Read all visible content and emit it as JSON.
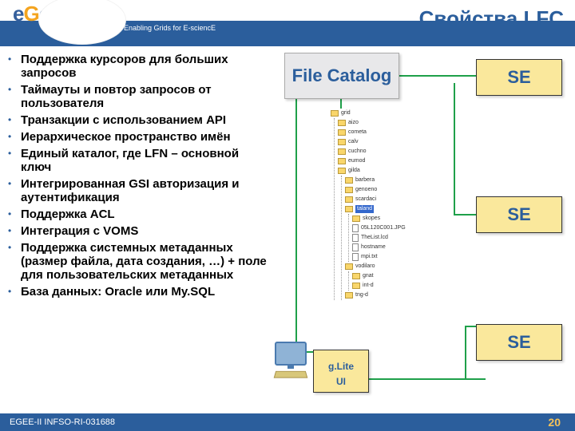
{
  "logo": {
    "tagline": "Enabling Grids for E-sciencE"
  },
  "title": "Свойства LFC",
  "bullets": [
    "Поддержка курсоров для больших запросов",
    "Таймауты и повтор запросов от пользователя",
    "Транзакции с использованием API",
    "Иерархическое пространство имён",
    "Единый каталог, где LFN – основной ключ",
    "Интегрированная GSI авторизация и аутентификация",
    "Поддержка ACL",
    "Интеграция с VOMS",
    "Поддержка системных метаданных (размер файла, дата создания, …) + поле для пользовательских метаданных",
    "База данных: Oracle или My.SQL"
  ],
  "boxes": {
    "file_catalog": "File Catalog",
    "se": "SE",
    "glite_l1": "g.Lite",
    "glite_l2": "UI"
  },
  "tree": {
    "root": "grid",
    "children": [
      "aizo",
      "cometa",
      "calv",
      "cuchno",
      "eumod"
    ],
    "gilda_label": "gilda",
    "gilda": [
      "barbera",
      "genoeno",
      "scardaci"
    ],
    "highlight": "taland",
    "files": [
      "skopes",
      "05L120C001.JPG",
      "TheList.lcd",
      "hostname",
      "mpi.txt"
    ],
    "trailing_folders": [
      "vodilaro",
      "gnat",
      "int-d",
      "tng-d"
    ]
  },
  "footer": {
    "left": "EGEE-II INFSO-RI-031688",
    "page": "20"
  }
}
